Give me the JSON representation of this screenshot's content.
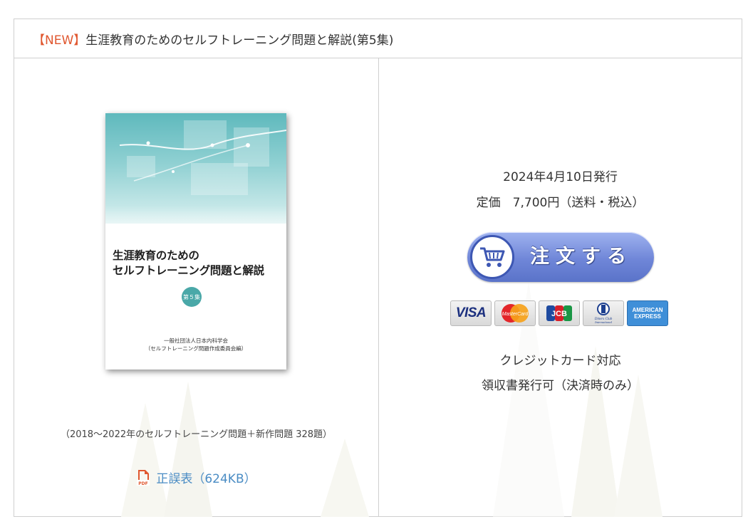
{
  "header": {
    "tag": "【NEW】",
    "title": "生涯教育のためのセルフトレーニング問題と解説(第5集)"
  },
  "book": {
    "cover_title_line1": "生涯教育のための",
    "cover_title_line2": "セルフトレーニング問題と解説",
    "volume_badge": "第５集",
    "publisher_line1": "一般社団法人日本内科学会",
    "publisher_line2": "（セルフトレーニング問題作成委員会編）",
    "accent_color": "#5fb9bd"
  },
  "caption": "（2018～2022年のセルフトレーニング問題＋新作問題 328題）",
  "errata": {
    "icon": "pdf-icon",
    "label": "正誤表（624KB）",
    "link_color": "#4a8cc4"
  },
  "purchase": {
    "issue_date": "2024年4月10日発行",
    "price": "定価　7,700円（送料・税込）",
    "order_button_label": "注文する",
    "order_button_icon": "cart-icon",
    "cards": [
      {
        "name": "visa-icon",
        "label": "VISA"
      },
      {
        "name": "mastercard-icon",
        "label": "MasterCard"
      },
      {
        "name": "jcb-icon",
        "label": "JCB"
      },
      {
        "name": "diners-club-icon",
        "label": "Diners Club International"
      },
      {
        "name": "american-express-icon",
        "label": "AMERICAN EXPRESS"
      }
    ],
    "note1": "クレジットカード対応",
    "note2": "領収書発行可（決済時のみ）"
  },
  "colors": {
    "new_tag": "#e0572f",
    "border": "#cfcfcf",
    "button": "#6f86d8"
  }
}
